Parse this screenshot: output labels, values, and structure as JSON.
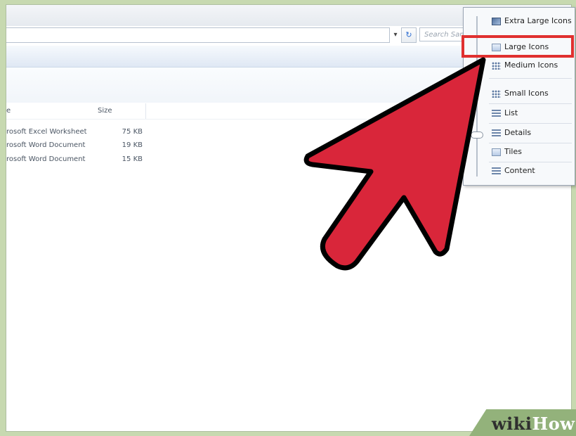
{
  "address_bar": {
    "search_placeholder": "Search Sam"
  },
  "file_list": {
    "columns": {
      "name_fragment": "e",
      "size": "Size"
    },
    "rows": [
      {
        "type": "rosoft Excel Worksheet",
        "size": "75 KB"
      },
      {
        "type": "rosoft Word Document",
        "size": "19 KB"
      },
      {
        "type": "rosoft Word Document",
        "size": "15 KB"
      }
    ]
  },
  "view_menu": {
    "items": [
      {
        "label": "Extra Large Icons",
        "icon": "extra-large-icons-icon"
      },
      {
        "label": "Large Icons",
        "icon": "large-icons-icon",
        "highlighted": true
      },
      {
        "label": "Medium Icons",
        "icon": "medium-icons-icon"
      },
      {
        "label": "Small Icons",
        "icon": "small-icons-icon"
      },
      {
        "label": "List",
        "icon": "list-icon"
      },
      {
        "label": "Details",
        "icon": "details-icon"
      },
      {
        "label": "Tiles",
        "icon": "tiles-icon"
      },
      {
        "label": "Content",
        "icon": "content-icon"
      }
    ]
  },
  "colors": {
    "highlight": "#e0302f",
    "arrow_fill": "#d9263a",
    "arrow_outline": "#000000",
    "watermark_bg": "#93b27b"
  },
  "watermark": {
    "part1": "wiki",
    "part2": "How"
  }
}
